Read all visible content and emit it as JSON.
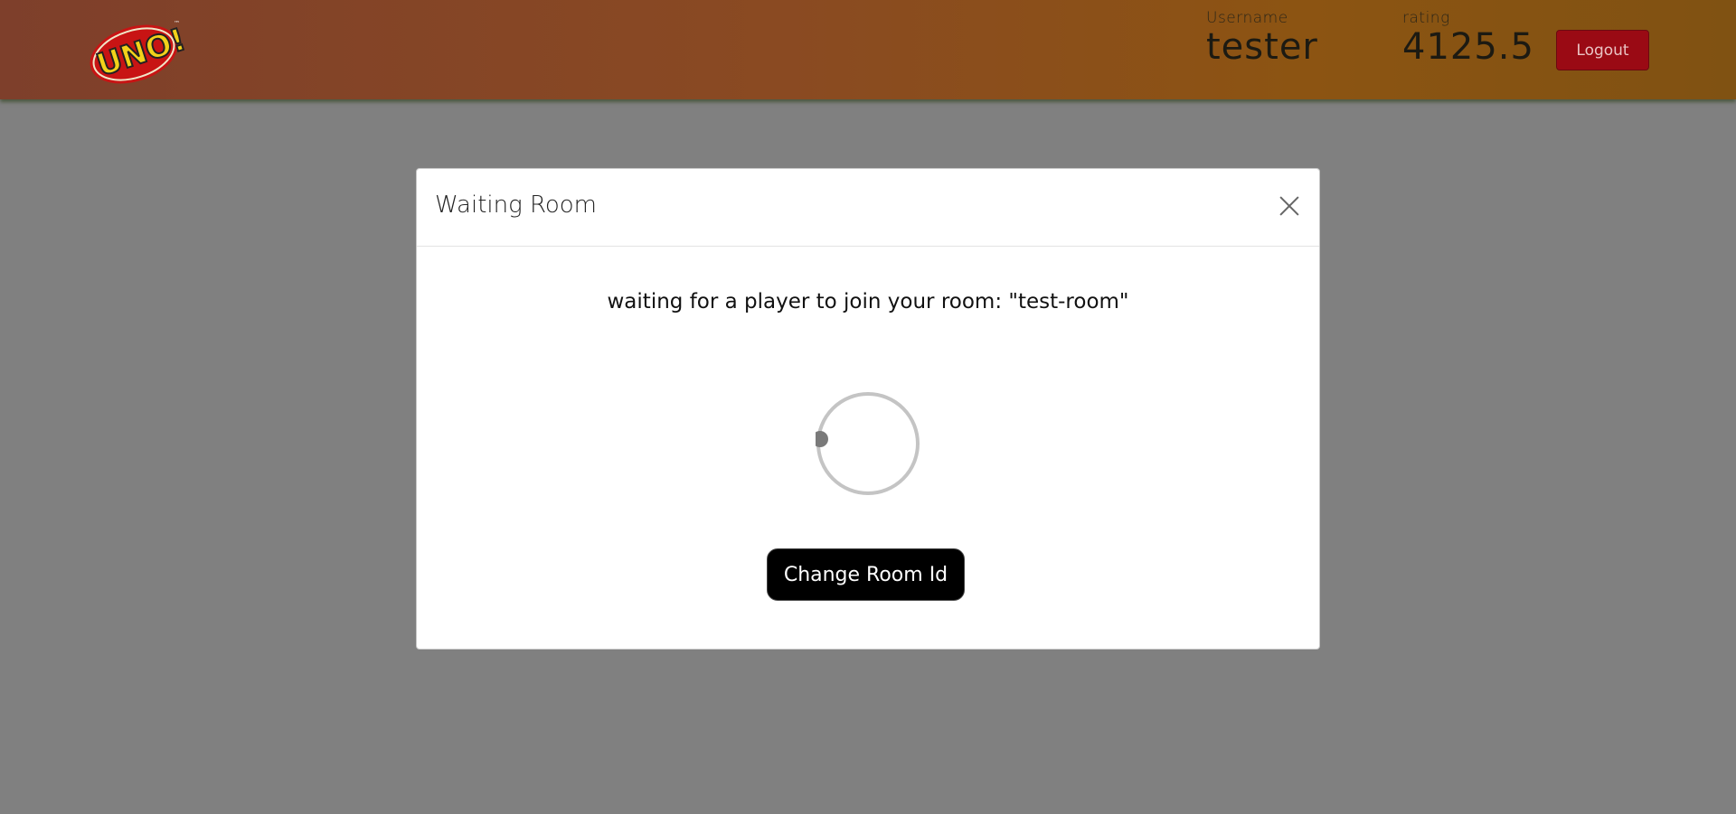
{
  "header": {
    "logo_text": "UNO!",
    "username_caption": "Username",
    "username_value": "tester",
    "rating_caption": "rating",
    "rating_value": "4125.5",
    "logout_label": "Logout"
  },
  "modal": {
    "title": "Waiting Room",
    "message": "waiting for a player to join your room: \"test-room\"",
    "change_room_label": "Change Room Id"
  },
  "colors": {
    "header_start": "#7e3f2b",
    "header_end": "#805212",
    "overlay": "#808080",
    "logout_bg": "#9a0a14",
    "button_bg": "#000000"
  },
  "icons": {
    "close": "close-icon",
    "spinner": "loading-spinner-icon"
  }
}
